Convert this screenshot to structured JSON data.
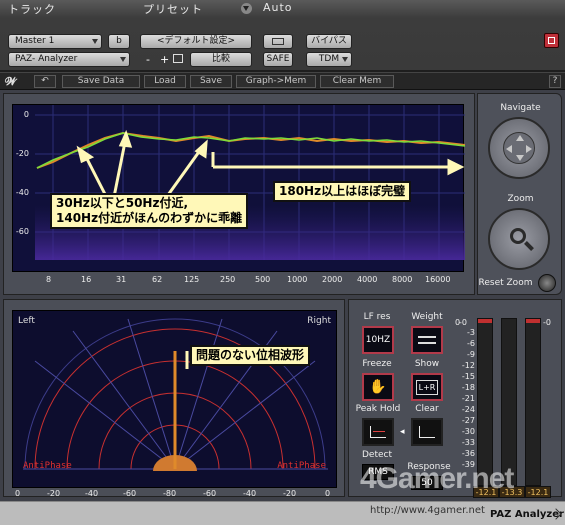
{
  "host": {
    "track_title": "トラック",
    "preset_title": "プリセット",
    "auto_title": "Auto",
    "track_name": "Master 1",
    "track_letter": "b",
    "plugin_name": "PAZ- Analyzer",
    "preset_value": "<デフォルト設定>",
    "minus": "-",
    "plus": "+",
    "compare_label": "比較",
    "bypass_label": "バイパス",
    "safe_label": "SAFE",
    "tdm_label": "TDM"
  },
  "toolbar": {
    "undo": "↶",
    "save_data": "Save Data",
    "load": "Load",
    "save": "Save",
    "graph_mem": "Graph->Mem",
    "clear_mem": "Clear Mem",
    "help": "?"
  },
  "analyzer": {
    "y_ticks": [
      "0",
      "-20",
      "-40",
      "-60"
    ],
    "x_ticks": [
      "8",
      "16",
      "31",
      "62",
      "125",
      "250",
      "500",
      "1000",
      "2000",
      "4000",
      "8000",
      "16000"
    ]
  },
  "navigate": {
    "title": "Navigate",
    "zoom": "Zoom",
    "reset_zoom": "Reset Zoom"
  },
  "phase": {
    "left_label": "Left",
    "right_label": "Right",
    "antiphase_left": "AntiPhase",
    "antiphase_right": "AntiPhase",
    "x_ticks": [
      "0",
      "-20",
      "-40",
      "-60",
      "-80",
      "-60",
      "-40",
      "-20",
      "0"
    ]
  },
  "controls": {
    "lf_res": "LF res",
    "lf_res_value": "10HZ",
    "weight": "Weight",
    "freeze": "Freeze",
    "show": "Show",
    "show_value": "L+R",
    "peak_hold": "Peak Hold",
    "clear": "Clear",
    "detect": "Detect",
    "detect_value": "RMS",
    "response": "Response",
    "response_value": "50"
  },
  "meter": {
    "scale": [
      "0",
      "-3",
      "-6",
      "-9",
      "-12",
      "-15",
      "-18",
      "-21",
      "-24",
      "-27",
      "-30",
      "-33",
      "-36",
      "-39"
    ],
    "readouts": [
      "-12.1",
      "-13.3",
      "-12.1"
    ],
    "scale_top_labels": [
      "-0",
      "-0"
    ]
  },
  "annotations": {
    "note_low": "30Hz以下と50Hz付近,",
    "note_low2": "140Hz付近がほんのわずかに乖離",
    "note_high": "180Hz以上はほぼ完璧",
    "note_phase": "問題のない位相波形"
  },
  "footer": {
    "brand": "PAZ Analyzer",
    "watermark": "4Gamer.net",
    "watermark_url": "http://www.4gamer.net"
  },
  "colors": {
    "accent_red": "#b23a4a",
    "trace_green": "#7ddc3a",
    "trace_orange": "#e08a2a",
    "annot_yellow": "#fff8b8"
  }
}
